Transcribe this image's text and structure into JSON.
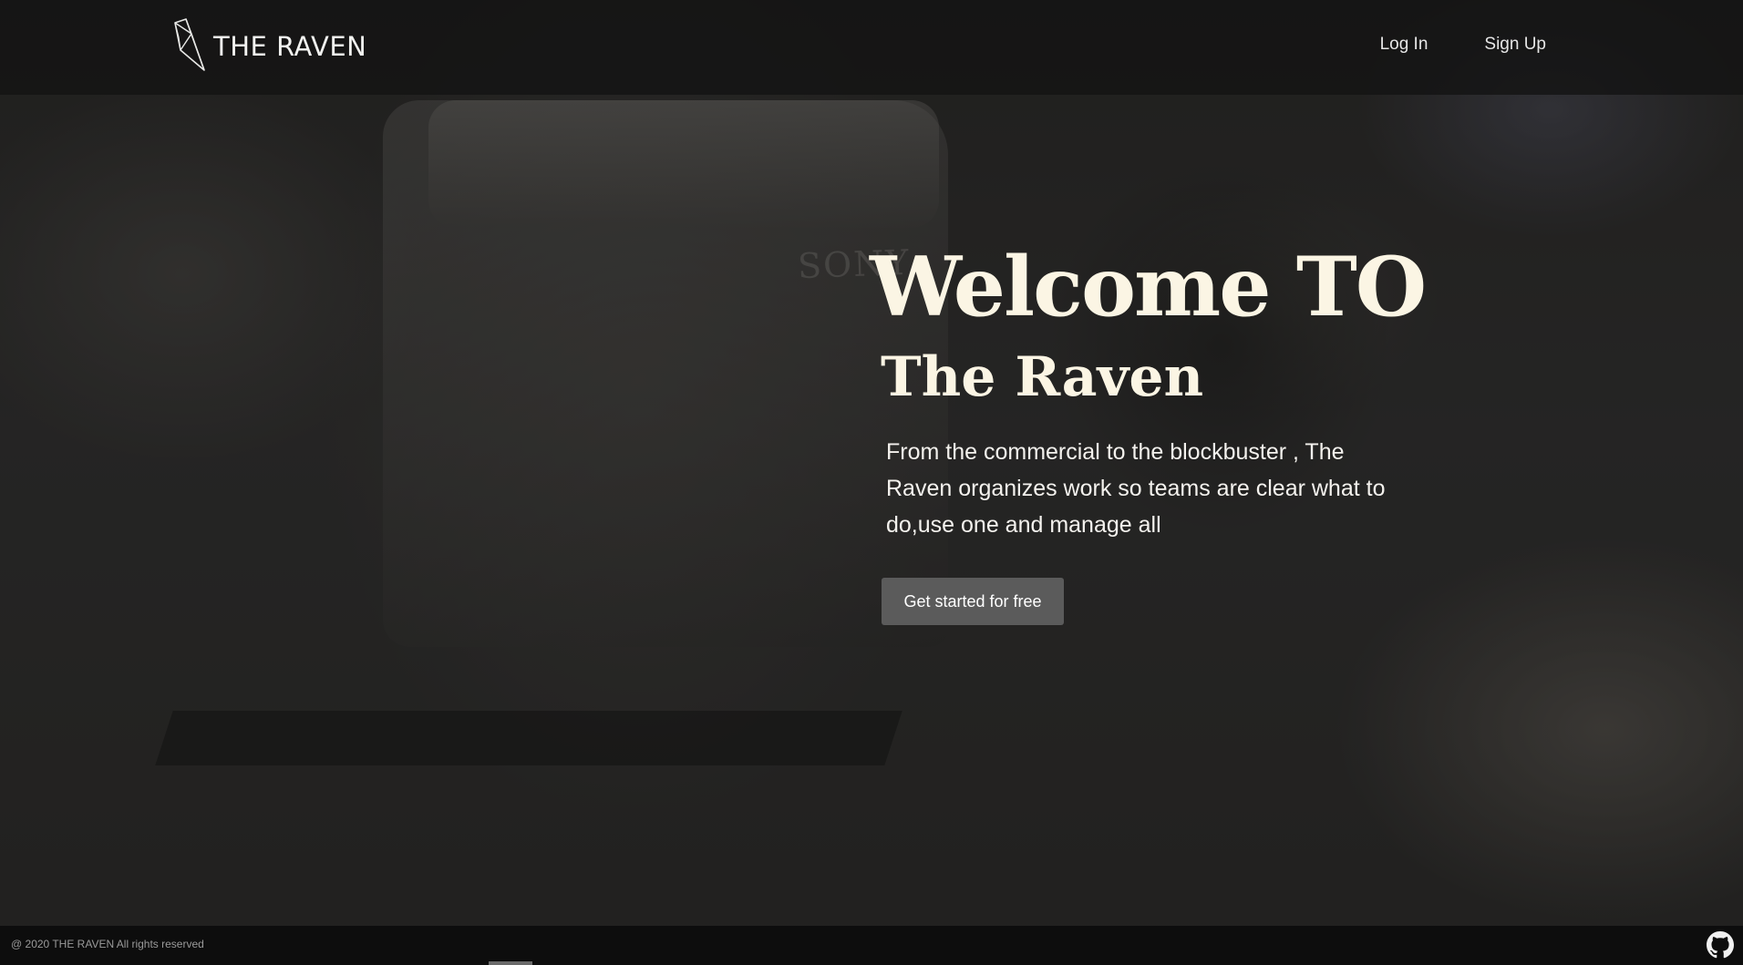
{
  "header": {
    "logo_text": "THE RAVEN",
    "nav": {
      "login_label": "Log In",
      "signup_label": "Sign Up"
    }
  },
  "background": {
    "brand_print": "SONY"
  },
  "hero": {
    "title": "Welcome TO",
    "subtitle": "The Raven",
    "description": "From the commercial to the blockbuster , The Raven organizes work so teams are clear what to do,use one and manage all",
    "cta_label": "Get started for free"
  },
  "footer": {
    "copyright": "@ 2020 THE RAVEN All rights reserved"
  },
  "icons": {
    "logo": "raven-logo-icon",
    "github": "github-icon"
  },
  "colors": {
    "heading": "#fbf5e4",
    "button": "#5b5b5b",
    "navbar": "#141414",
    "footer": "#0d0d0d"
  }
}
